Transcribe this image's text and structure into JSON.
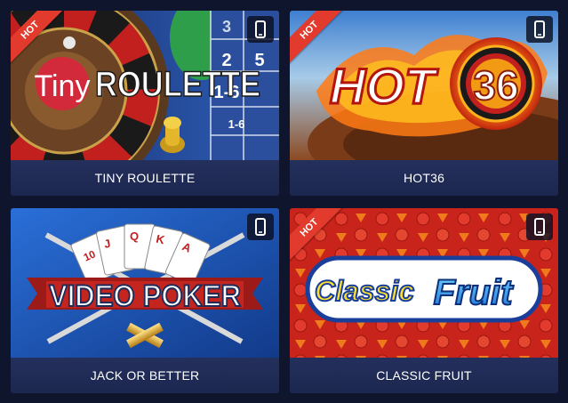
{
  "games": [
    {
      "title": "TINY ROULETTE",
      "badge": "HOT",
      "logo_a": "Tiny",
      "logo_b": "ROULETTE",
      "mobile_icon": "mobile-phone-icon"
    },
    {
      "title": "HOT36",
      "badge": "HOT",
      "logo_a": "HOT",
      "logo_b": "36",
      "mobile_icon": "mobile-phone-icon"
    },
    {
      "title": "JACK OR BETTER",
      "logo_a": "VIDEO",
      "logo_b": "POKER",
      "mobile_icon": "mobile-phone-icon"
    },
    {
      "title": "CLASSIC FRUIT",
      "badge": "HOT",
      "logo_a": "Classic",
      "logo_b": "Fruit",
      "mobile_icon": "mobile-phone-icon"
    }
  ],
  "roulette_numbers": [
    "3",
    "2",
    "5",
    "1-6"
  ],
  "card_ranks": [
    "10",
    "J",
    "Q",
    "K",
    "A"
  ],
  "colors": {
    "background": "#10152e",
    "caption_bg": "#1f2a52",
    "hot_badge": "#e23b2d"
  }
}
